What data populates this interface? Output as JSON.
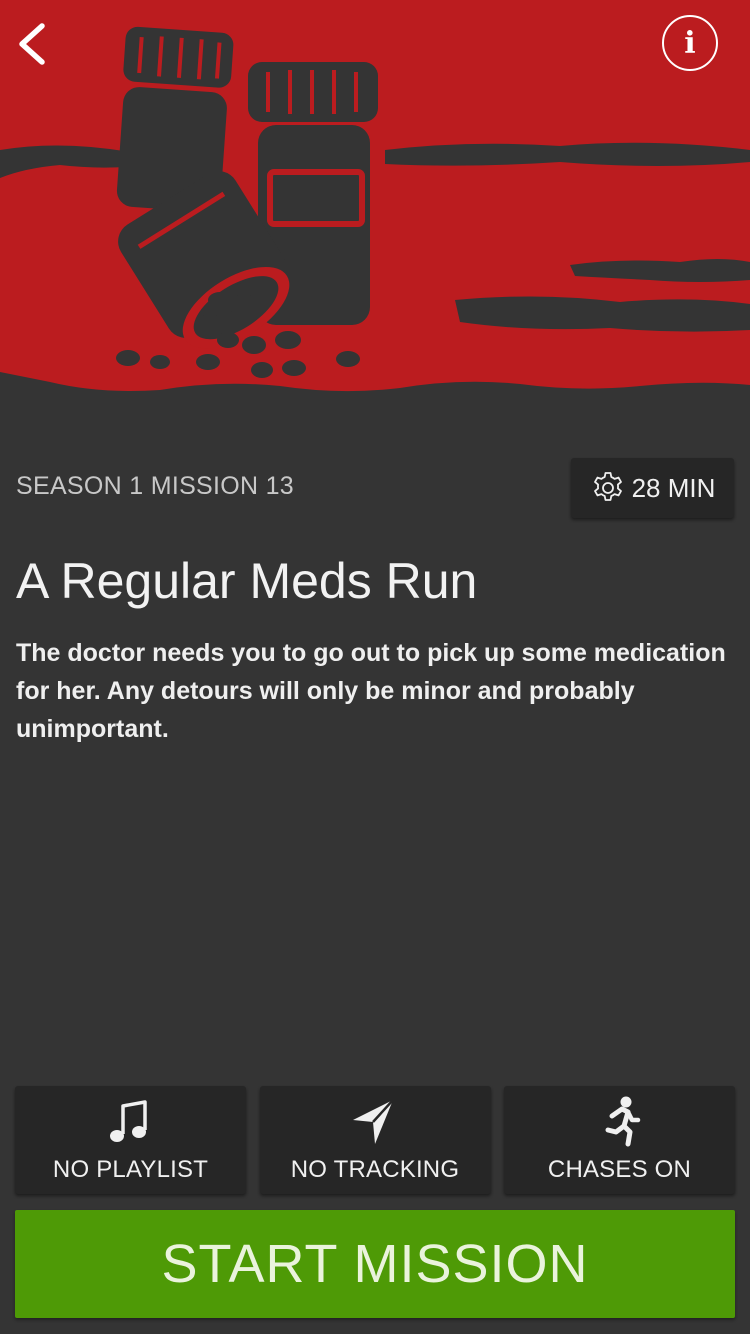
{
  "colors": {
    "hero_red": "#b71c1c",
    "background": "#343434",
    "chip_bg": "#262626",
    "start_green": "#4e9a06"
  },
  "header": {
    "back_icon": "chevron-left-icon",
    "info_icon": "info-icon",
    "info_glyph": "i"
  },
  "hero": {
    "illustration": "pill-bottles-illustration"
  },
  "mission": {
    "season_label": "SEASON 1 MISSION 13",
    "duration": "28 MIN",
    "title": "A Regular Meds Run",
    "description": "The doctor needs you to go out to pick up some medication for her. Any detours will only be minor and probably unimportant."
  },
  "options": [
    {
      "icon": "music-note-icon",
      "label": "NO PLAYLIST"
    },
    {
      "icon": "location-arrow-icon",
      "label": "NO TRACKING"
    },
    {
      "icon": "running-man-icon",
      "label": "CHASES ON"
    }
  ],
  "start_button": {
    "label": "START MISSION"
  }
}
